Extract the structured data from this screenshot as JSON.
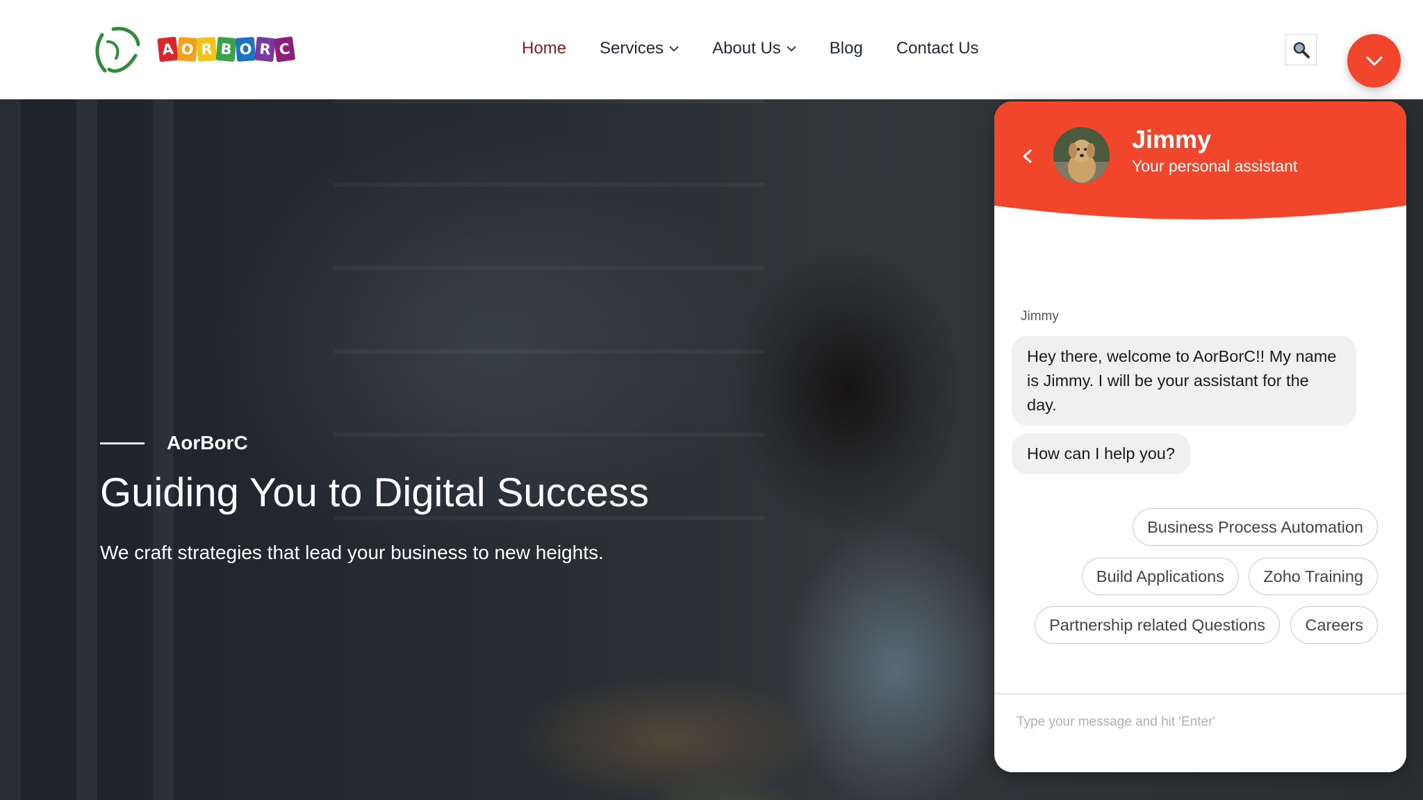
{
  "brand": {
    "logo_letters": [
      "A",
      "O",
      "R",
      "B",
      "O",
      "R",
      "C"
    ],
    "logo_colors": [
      "#d9262b",
      "#f4a11d",
      "#f2c318",
      "#3aa34a",
      "#1e73be",
      "#7a3aa0",
      "#8d1e7a"
    ],
    "logo_mark_color": "#2e8b3a"
  },
  "nav": {
    "items": [
      {
        "label": "Home",
        "active": true
      },
      {
        "label": "Services",
        "dropdown": true
      },
      {
        "label": "About Us",
        "dropdown": true
      },
      {
        "label": "Blog"
      },
      {
        "label": "Contact Us"
      }
    ],
    "search_icon": "search-icon",
    "toggle_icon": "chevron-down-icon"
  },
  "hero": {
    "kicker": "AorBorC",
    "title": "Guiding You to Digital Success",
    "subtitle": "We craft strategies that lead your business to new heights."
  },
  "chat": {
    "accent": "#f2462c",
    "agent_name": "Jimmy",
    "agent_role": "Your personal assistant",
    "back_icon": "chevron-left-icon",
    "sender_label": "Jimmy",
    "messages": [
      "Hey there, welcome to AorBorC!! My name is Jimmy. I will be your assistant for the day.",
      "How can I help you?"
    ],
    "quick_replies": [
      "Business Process Automation",
      "Build Applications",
      "Zoho Training",
      "Partnership related Questions",
      "Careers"
    ],
    "input_placeholder": "Type your message and hit 'Enter'"
  }
}
